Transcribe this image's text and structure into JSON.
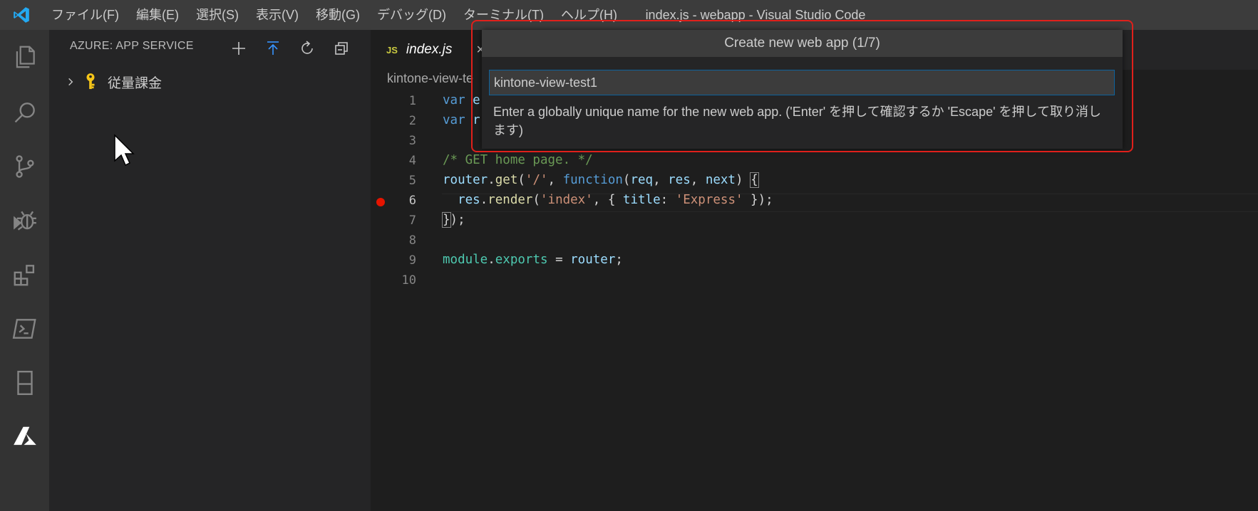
{
  "window": {
    "title": "index.js - webapp - Visual Studio Code"
  },
  "menu": [
    "ファイル(F)",
    "編集(E)",
    "選択(S)",
    "表示(V)",
    "移動(G)",
    "デバッグ(D)",
    "ターミナル(T)",
    "ヘルプ(H)"
  ],
  "activity_icons": [
    "explorer-icon",
    "search-icon",
    "source-control-icon",
    "debug-icon",
    "extensions-icon",
    "terminal-icon",
    "remote-icon",
    "azure-icon"
  ],
  "sidebar": {
    "header": "AZURE: APP SERVICE",
    "actions": [
      "add-icon",
      "deploy-icon",
      "refresh-icon",
      "collapse-icon"
    ],
    "tree_item": "従量課金"
  },
  "editor": {
    "tab": {
      "badge": "JS",
      "name": "index.js",
      "close": "×"
    },
    "breadcrumb": "kintone-view-te",
    "line_numbers": [
      "1",
      "2",
      "3",
      "4",
      "5",
      "6",
      "7",
      "8",
      "9",
      "10"
    ],
    "code_visible": {
      "l1_kw": "var",
      "l1_rest": " e",
      "l2_kw": "var",
      "l2_rest": " r",
      "l4": "/* GET home page. */",
      "l5_a": "router",
      "l5_b": ".",
      "l5_c": "get",
      "l5_d": "(",
      "l5_e": "'/'",
      "l5_f": ", ",
      "l5_g": "function",
      "l5_h": "(",
      "l5_i": "req",
      "l5_j": ", ",
      "l5_k": "res",
      "l5_l": ", ",
      "l5_m": "next",
      "l5_n": ") ",
      "l5_o": "{",
      "l6_a": "  ",
      "l6_b": "res",
      "l6_c": ".",
      "l6_d": "render",
      "l6_e": "(",
      "l6_f": "'index'",
      "l6_g": ", { ",
      "l6_h": "title",
      "l6_i": ": ",
      "l6_j": "'Express'",
      "l6_k": " });",
      "l7_a": "}",
      "l7_b": ");",
      "l9_a": "module",
      "l9_b": ".",
      "l9_c": "exports",
      "l9_d": " = ",
      "l9_e": "router",
      "l9_f": ";"
    }
  },
  "quick_input": {
    "title": "Create new web app (1/7)",
    "value": "kintone-view-test1",
    "message": "Enter a globally unique name for the new web app. ('Enter' を押して確認するか 'Escape' を押して取り消します)"
  },
  "colors": {
    "accent": "#0e639c",
    "highlight_box": "#e0201b",
    "breakpoint": "#e51400"
  }
}
